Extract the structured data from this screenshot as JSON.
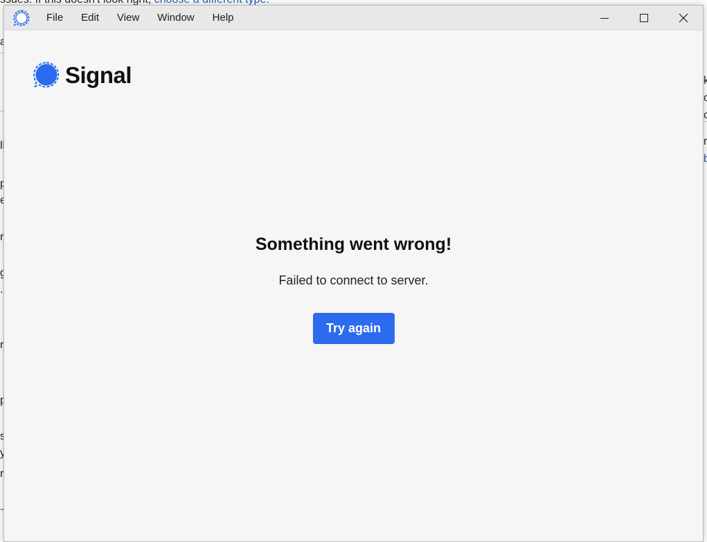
{
  "background_document": {
    "top_text": "ssues. If this doesn't look right,",
    "top_link": "choose a different type.",
    "left_fragments": [
      "a",
      "ll",
      "p",
      "e",
      "r",
      "g",
      ".",
      "ri",
      "p",
      "s",
      "y",
      "r",
      "-l"
    ],
    "right_fragments": [
      "k",
      "o",
      "c",
      "r",
      "b"
    ]
  },
  "window": {
    "menu": [
      "File",
      "Edit",
      "View",
      "Window",
      "Help"
    ],
    "controls": {
      "minimize_icon": "minimize-icon",
      "maximize_icon": "maximize-icon",
      "close_icon": "close-icon"
    }
  },
  "brand": {
    "name": "Signal",
    "color": "#2c6bed"
  },
  "error": {
    "title": "Something went wrong!",
    "message": "Failed to connect to server.",
    "button": "Try again"
  }
}
